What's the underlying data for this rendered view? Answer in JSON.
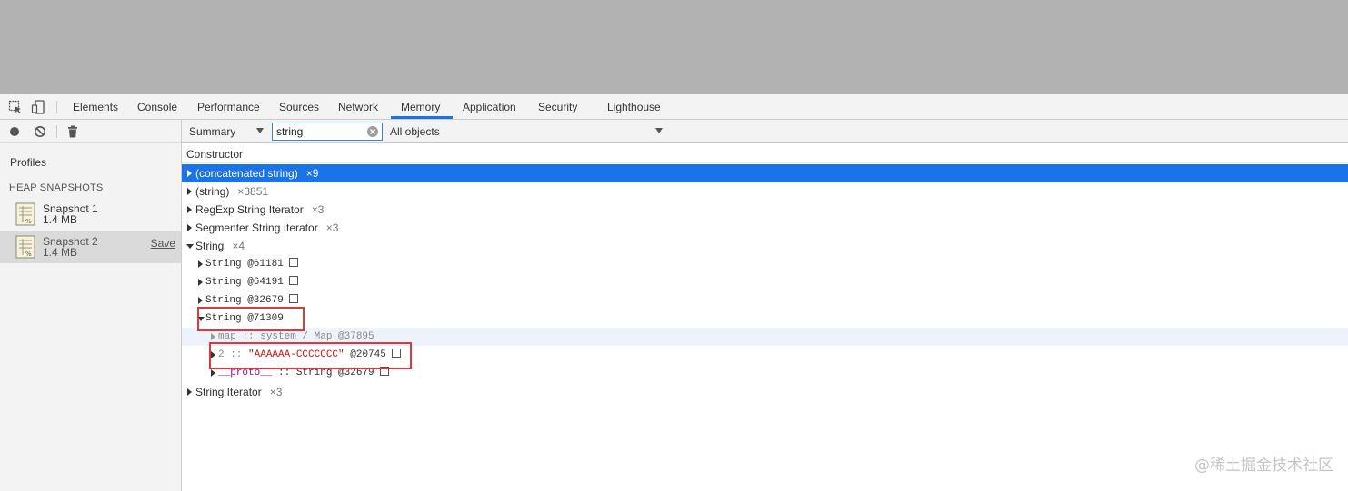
{
  "devtools": {
    "tabs": [
      "Elements",
      "Console",
      "Performance",
      "Sources",
      "Network",
      "Memory",
      "Application",
      "Security",
      "Lighthouse"
    ],
    "active_tab": "Memory"
  },
  "sidebar": {
    "title": "Profiles",
    "section_header": "HEAP SNAPSHOTS",
    "snapshots": [
      {
        "name": "Snapshot 1",
        "size": "1.4 MB"
      },
      {
        "name": "Snapshot 2",
        "size": "1.4 MB",
        "save_label": "Save"
      }
    ]
  },
  "toolbar": {
    "view_select": "Summary",
    "filter_value": "string",
    "filter_select": "All objects"
  },
  "table": {
    "header": "Constructor",
    "rows": [
      {
        "name": "(concatenated string)",
        "count": "×9"
      },
      {
        "name": "(string)",
        "count": "×3851"
      },
      {
        "name": "RegExp String Iterator",
        "count": "×3"
      },
      {
        "name": "Segmenter String Iterator",
        "count": "×3"
      },
      {
        "name": "String",
        "count": "×4"
      },
      {
        "name": "String @61181"
      },
      {
        "name": "String @64191"
      },
      {
        "name": "String @32679"
      },
      {
        "name": "String @71309"
      },
      {
        "prefix": "map :: ",
        "name": "system / Map @37895"
      },
      {
        "prefix": "2 :: ",
        "value": "\"AAAAAA-CCCCCCC\"",
        "suffix": " @20745"
      },
      {
        "prefix": "__proto__",
        "name": " :: String @32679"
      },
      {
        "name": "String Iterator",
        "count": "×3"
      }
    ]
  },
  "colors": {
    "selection": "#1a73e8",
    "annotation": "#e0383a"
  },
  "watermark": "@稀土掘金技术社区"
}
